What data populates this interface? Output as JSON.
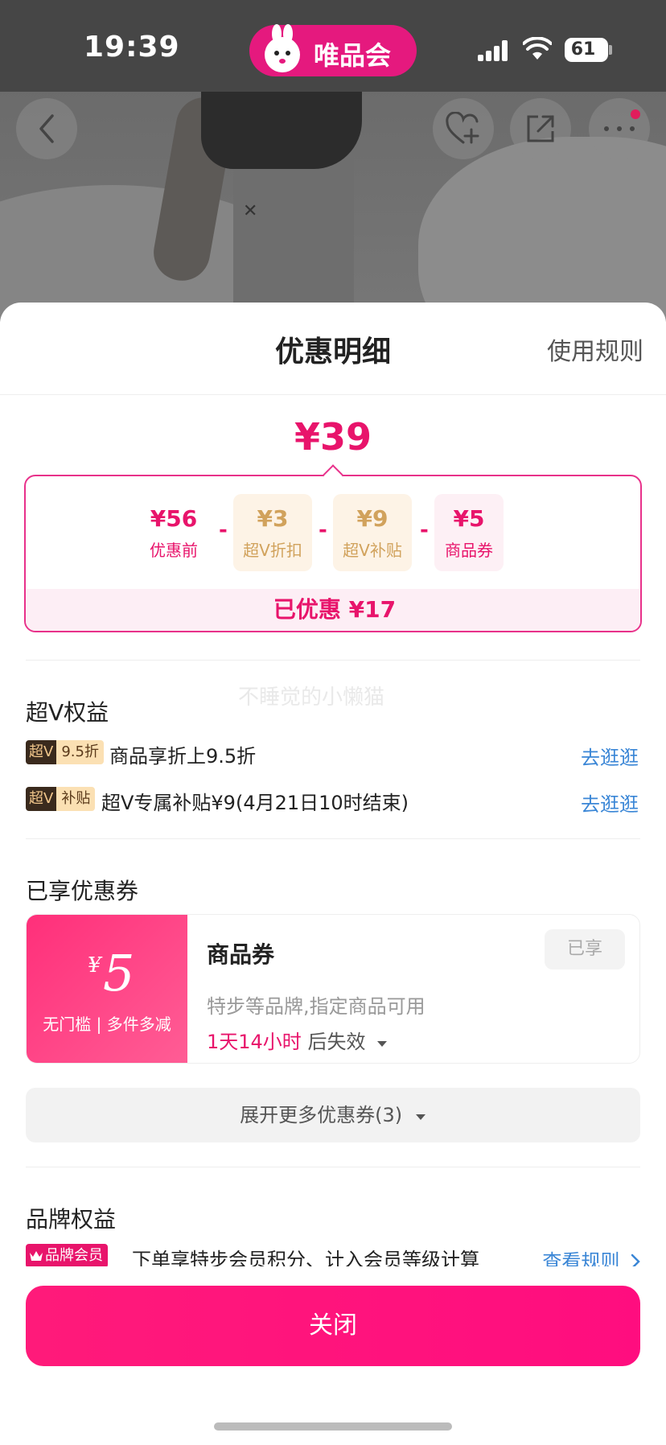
{
  "status_bar": {
    "time": "19:39",
    "app_name": "唯品会",
    "battery": "61"
  },
  "sheet": {
    "title": "优惠明细",
    "rules_link": "使用规则",
    "final_price": "¥39",
    "breakdown": [
      {
        "amount": "¥56",
        "label": "优惠前"
      },
      {
        "amount": "¥3",
        "label": "超V折扣"
      },
      {
        "amount": "¥9",
        "label": "超V补贴"
      },
      {
        "amount": "¥5",
        "label": "商品券"
      }
    ],
    "minus_sign": "-",
    "saved": "已优惠 ¥17",
    "watermark": "不睡觉的小懒猫"
  },
  "super_v": {
    "title": "超V权益",
    "items": [
      {
        "tag_a": "超V",
        "tag_b": "9.5折",
        "text": "商品享折上9.5折",
        "link": "去逛逛"
      },
      {
        "tag_a": "超V",
        "tag_b": "补贴",
        "text": "超V专属补贴¥9(4月21日10时结束)",
        "link": "去逛逛"
      }
    ]
  },
  "coupons": {
    "title": "已享优惠券",
    "coupon": {
      "currency": "¥",
      "value": "5",
      "condition": "无门槛 | 多件多减",
      "name": "商品券",
      "desc": "特步等品牌,指定商品可用",
      "expire_time": "1天14小时",
      "expire_suffix": "后失效",
      "status": "已享"
    },
    "expand_label": "展开更多优惠券(3)"
  },
  "brand": {
    "title": "品牌权益",
    "tag": "品牌会员",
    "text": "下单享特步会员积分、计入会员等级计算",
    "link": "查看规则"
  },
  "close_label": "关闭",
  "colors": {
    "accent": "#e8146b",
    "link": "#3a86d6",
    "brand_pink": "#e5197e"
  }
}
